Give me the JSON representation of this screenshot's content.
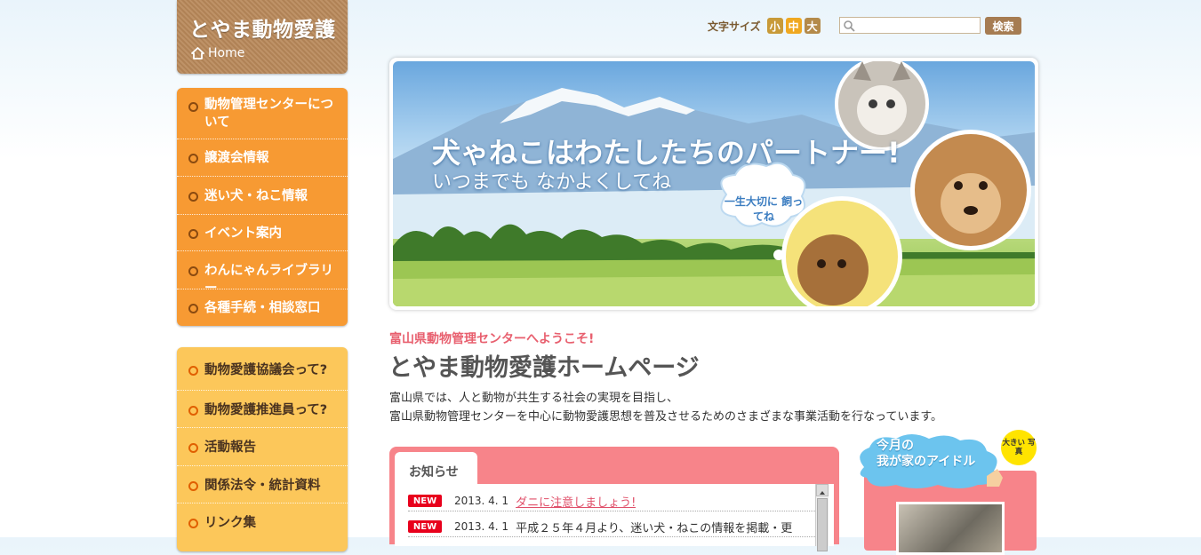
{
  "site": {
    "logo_text": "とやま動物愛護",
    "home_label": "Home"
  },
  "header": {
    "font_size_label": "文字サイズ",
    "font_sizes": [
      "小",
      "中",
      "大"
    ],
    "search_placeholder": "",
    "search_button": "検索"
  },
  "nav_primary": [
    {
      "label": "動物管理センターについて"
    },
    {
      "label": "譲渡会情報"
    },
    {
      "label": "迷い犬・ねこ情報"
    },
    {
      "label": "イベント案内"
    },
    {
      "label": "わんにゃんライブラリー"
    },
    {
      "label": "各種手続・相談窓口"
    }
  ],
  "nav_secondary": [
    {
      "label": "動物愛護協議会って?"
    },
    {
      "label": "動物愛護推進員って?"
    },
    {
      "label": "活動報告"
    },
    {
      "label": "関係法令・統計資料"
    },
    {
      "label": "リンク集"
    }
  ],
  "hero": {
    "title": "犬ゃねこはわたしたちのパートナー!",
    "subtitle": "いつまでも なかよくしてね",
    "bubble": "一生大切に 飼ってね"
  },
  "intro": {
    "welcome": "富山県動物管理センターへようこそ!",
    "title": "とやま動物愛護ホームページ",
    "line1": "富山県では、人と動物が共生する社会の実現を目指し、",
    "line2": "富山県動物管理センターを中心に動物愛護思想を普及させるためのさまざまな事業活動を行なっています。"
  },
  "news": {
    "tab_label": "お知らせ",
    "items": [
      {
        "badge": "NEW",
        "date": "2013. 4. 1",
        "text": "ダニに注意しましょう!"
      },
      {
        "badge": "NEW",
        "date": "2013. 4. 1",
        "text": "平成２５年４月より、迷い犬・ねこの情報を掲載・更"
      }
    ]
  },
  "idol": {
    "title_line1": "今月の",
    "title_line2": "我が家のアイドル",
    "badge": "大きい 写真"
  },
  "colors": {
    "nav_primary_bg": "#f79a33",
    "nav_secondary_bg": "#fcc75a",
    "accent_pink": "#f7848a",
    "new_badge": "#e8001c",
    "logo_bg": "#b9895a"
  }
}
